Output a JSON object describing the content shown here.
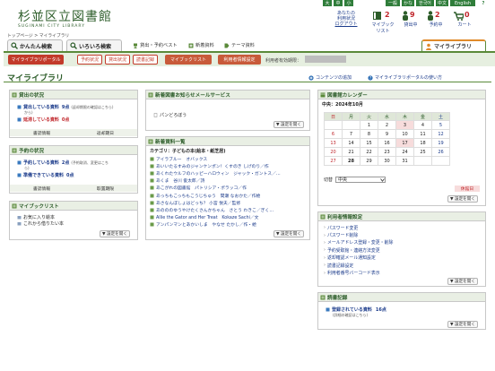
{
  "topbar": {
    "size_large": "大",
    "size_mid": "中",
    "size_small": "小",
    "lang_general": "一般",
    "lang_kana": "かな",
    "lang_ko": "한국어",
    "lang_zh": "中文",
    "lang_en": "English",
    "help": "?"
  },
  "header": {
    "logo_jp": "杉並区立図書館",
    "logo_en": "SUGINAMI CITY LIBRARY",
    "user_line1": "あなたの",
    "user_line2": "利用状況",
    "user_line3": "ログアウト",
    "mylist_count": "2",
    "mylist_label": "マイブック",
    "mylist_label2": "リスト",
    "lending_count": "9",
    "lending_label": "貸出中",
    "reserve_count": "2",
    "reserve_label": "予約中",
    "cart_count": "0",
    "cart_label": "カート"
  },
  "breadcrumb": "トップページ > マイライブラリ",
  "tabs": {
    "easy": "かんたん検索",
    "various": "いろいろ検索",
    "mylib": "マイライブラリ"
  },
  "nav": {
    "best": "貸出・予約ベスト",
    "new": "新着資料",
    "theme": "テーマ資料"
  },
  "subnav": [
    "マイライブラリポータル",
    "予約状況",
    "貸出状況",
    "読書記録",
    "マイブックリスト",
    "利用者情報設定"
  ],
  "expiry_label": "利用者有効期限：",
  "expiry_value": "",
  "page_title": "マイライブラリ",
  "content_add": "コンテンツの追加",
  "portal_usage": "マイライブラリポータルの使い方",
  "lending": {
    "title": "貸出の状況",
    "row1_label": "貸出している資料",
    "row1_count": "9点",
    "row1_note": "(返却期限の確認はこちら)",
    "row1_note2": "から)",
    "row2_label": "延滞している資料",
    "row2_count": "0点",
    "foot_a": "書誌情報",
    "foot_b": "返却期日"
  },
  "reserve": {
    "title": "予約の状況",
    "row1_label": "予約している資料",
    "row1_count": "2点",
    "row1_note": "(予約取消、変更はこち",
    "row1_note2": "ら)",
    "row2_label": "準備できている資料",
    "row2_count": "0点",
    "foot_a": "書誌情報",
    "foot_b": "取置期限"
  },
  "mybook": {
    "title": "マイブックリスト",
    "items": [
      "お気に入り絵本",
      "これから借りたい本"
    ],
    "setting": "▼ 設定を開く"
  },
  "mail": {
    "title": "新着図書お知らせメールサービス",
    "items": [
      "パンどろぼう"
    ],
    "setting": "▼ 設定を開く"
  },
  "newbooks": {
    "title": "新着資料一覧",
    "category": "カテゴリ：子どもの本(絵本・紙芝居)",
    "items": [
      "アイラブルー　オバックス",
      "あいいたるすみのジャンケンポン！くすのき しげのり／作",
      "あくれたウルフのハッピーハロウィン　ジャック・ガントス／…",
      "あくま　谷川 俊太郎／詩",
      "あこがれの図書館　パトリシア・ポラッコ／作",
      "あっちもこっちもこうじちゅう　間瀬 なおかた／作絵",
      "あさなんぼしょはどっち？ 小宮 悦夫／監修",
      "あのののゆうやけたくさんかちゃん　さとう わきこ／ぎく…",
      "Allie the Gator and Her Treat　Kokaze Sachi／文",
      "アンパンマンとあかいしま　やなせ たかし／作・絵"
    ],
    "setting": "▼ 設定を開く"
  },
  "calendar": {
    "title": "図書館カレンダー",
    "month": "中央：2024年10月",
    "weekdays": [
      "日",
      "月",
      "火",
      "水",
      "木",
      "金",
      "土"
    ],
    "weeks": [
      [
        "",
        "",
        "1",
        "2",
        "3",
        "4",
        "5"
      ],
      [
        "6",
        "7",
        "8",
        "9",
        "10",
        "11",
        "12"
      ],
      [
        "13",
        "14",
        "15",
        "16",
        "17",
        "18",
        "19"
      ],
      [
        "20",
        "21",
        "22",
        "23",
        "24",
        "25",
        "26"
      ],
      [
        "27",
        "28",
        "29",
        "30",
        "31",
        "",
        ""
      ]
    ],
    "switch_label": "切替",
    "switch_value": "中央",
    "closed_legend": "休館日",
    "setting": "▼ 設定を開く"
  },
  "userinfo": {
    "title": "利用者情報設定",
    "items": [
      "パスワード変更",
      "パスワード削除",
      "メールアドレス登録・変更・削除",
      "予約受取館・連絡方法変更",
      "返却確認メール通知設定",
      "読書記録設定",
      "利用者番号バーコード表示"
    ],
    "setting": "▼ 設定を開く"
  },
  "reading": {
    "title": "読書記録",
    "label": "登録されている資料",
    "count": "16点",
    "note": "(詳細の確認はこちら)",
    "setting": "▼ 設定を開く"
  },
  "colors": {
    "brand_green": "#2d5d2a",
    "accent_red": "#c0262b",
    "link_blue": "#1a3a8a"
  }
}
